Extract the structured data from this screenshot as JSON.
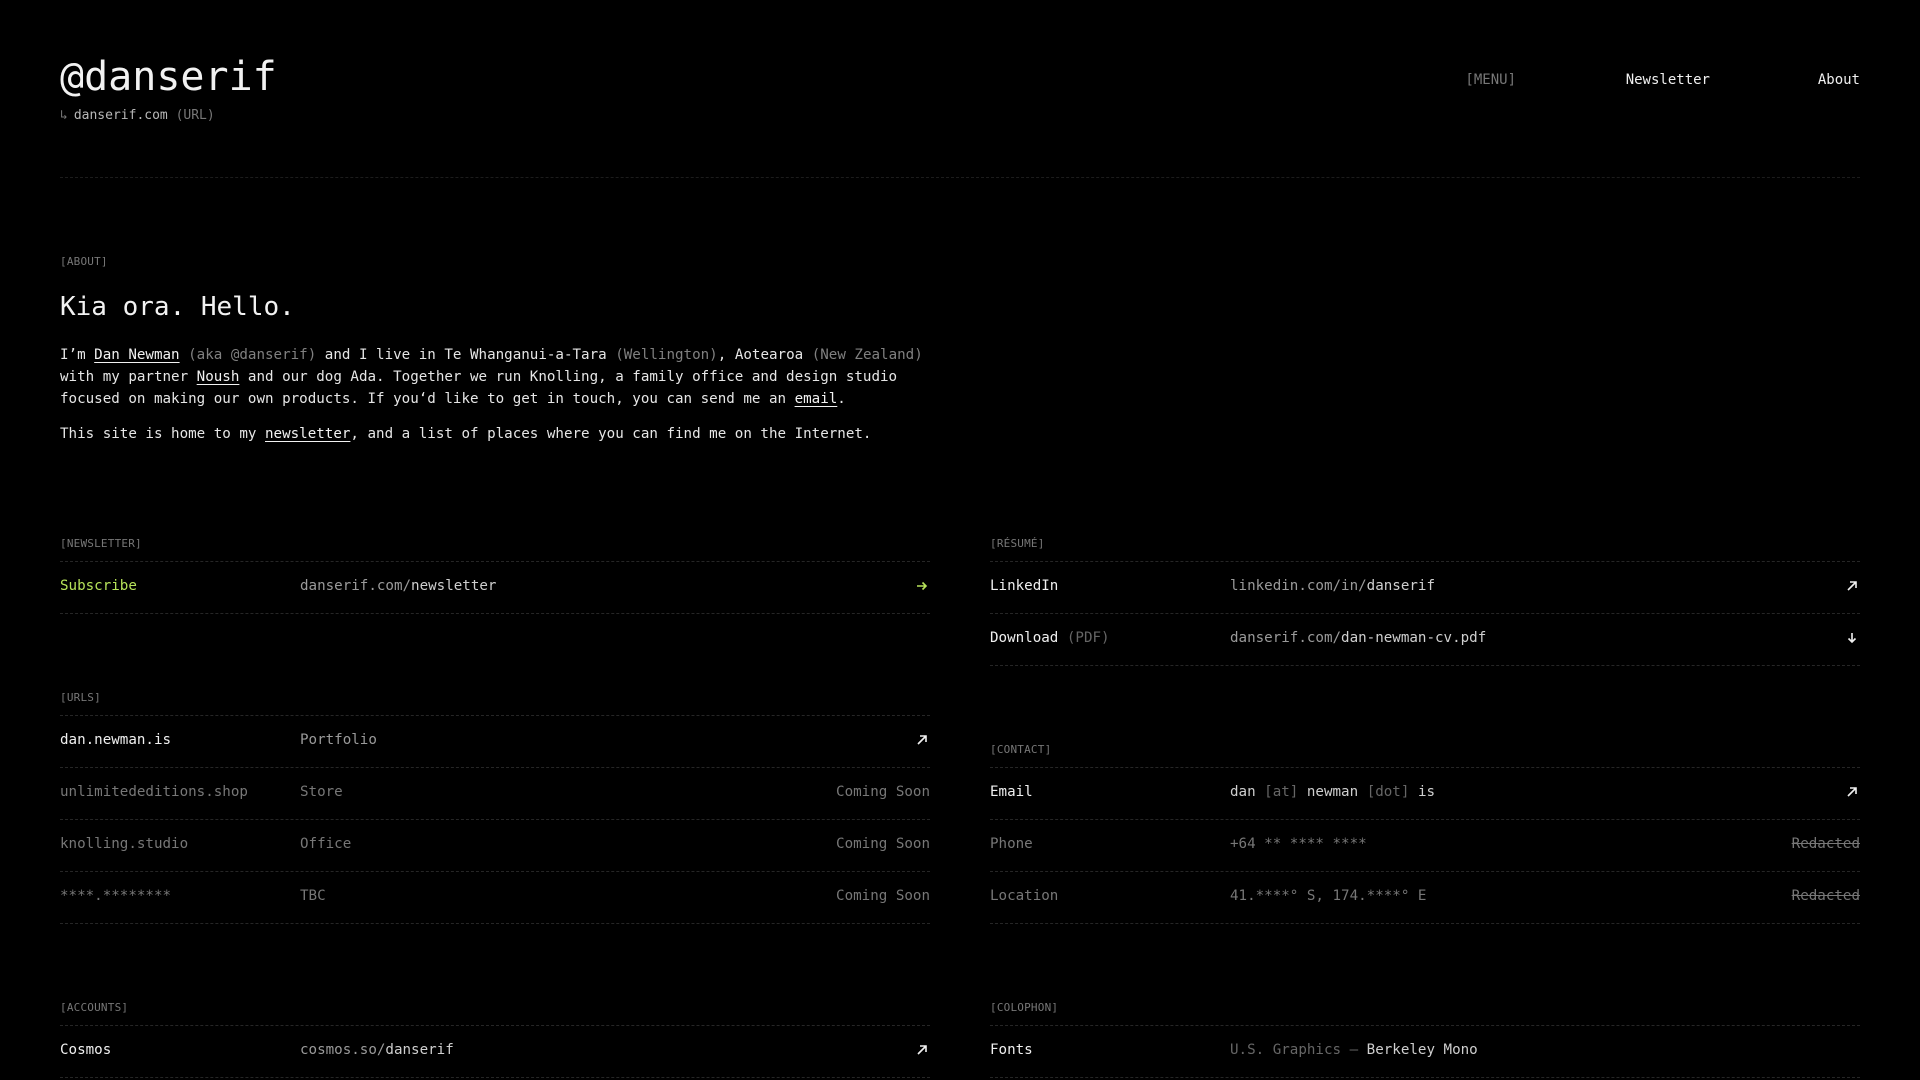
{
  "header": {
    "logo": "@danserif",
    "sub_arrow": "↳",
    "sub_domain": "danserif.com",
    "sub_tag": "(URL)",
    "nav": {
      "menu": "[MENU]",
      "newsletter": "Newsletter",
      "about": "About"
    }
  },
  "about": {
    "label": "[ABOUT]",
    "title": "Kia ora. Hello.",
    "p1": {
      "t1": "I’m ",
      "name": "Dan Newman",
      "aka": " (aka @danserif)",
      "t2": " and I live in Te Whanganui-a-Tara",
      "wellington": " (Wellington)",
      "t3": ", Aotearoa",
      "nz": " (New Zealand)",
      "t4": " with my partner ",
      "partner": "Noush",
      "t5": " and our dog Ada. Together we run Knolling, a family office and design studio focused on making our own products. If you‘d like to get in touch, you can send me an ",
      "email": "email",
      "t6": "."
    },
    "p2": {
      "t1": "This site is home to my ",
      "newsletter": "newsletter",
      "t2": ", and a list of places where you can find me on the Internet."
    }
  },
  "newsletter": {
    "label": "[NEWSLETTER]",
    "rows": [
      {
        "name": "Subscribe",
        "url_dim": "danserif.com/",
        "url_hi": "newsletter"
      }
    ]
  },
  "urls": {
    "label": "[URLS]",
    "rows": [
      {
        "name": "dan.newman.is",
        "desc": "Portfolio",
        "status": ""
      },
      {
        "name": "unlimitededitions.shop",
        "desc": "Store",
        "status": "Coming Soon"
      },
      {
        "name": "knolling.studio",
        "desc": "Office",
        "status": "Coming Soon"
      },
      {
        "name": "****.********",
        "desc": "TBC",
        "status": "Coming Soon"
      }
    ]
  },
  "accounts": {
    "label": "[ACCOUNTS]",
    "rows": [
      {
        "name": "Cosmos",
        "url_dim": "cosmos.so/",
        "url_hi": "danserif"
      }
    ]
  },
  "resume": {
    "label": "[RÉSUMÉ]",
    "rows": [
      {
        "name": "LinkedIn",
        "url_dim": "linkedin.com/in/",
        "url_hi": "danserif"
      },
      {
        "name": "Download",
        "name_tag": " (PDF)",
        "url_dim": "danserif.com/",
        "url_hi": "dan-newman-cv.pdf"
      }
    ]
  },
  "contact": {
    "label": "[CONTACT]",
    "rows": [
      {
        "name": "Email",
        "v1": "dan ",
        "v2": "[at]",
        "v3": " newman ",
        "v4": "[dot]",
        "v5": " is"
      },
      {
        "name": "Phone",
        "value": "+64 ** **** ****",
        "status": "Redacted"
      },
      {
        "name": "Location",
        "value": "41.****° S, 174.****° E",
        "status": "Redacted"
      }
    ]
  },
  "colophon": {
    "label": "[COLOPHON]",
    "rows": [
      {
        "name": "Fonts",
        "v_dim": "U.S. Graphics — ",
        "v_hi": "Berkeley Mono"
      }
    ]
  },
  "colors": {
    "background": "#000000",
    "accent_green": "#b7e35a",
    "text": "#e8e8e8",
    "muted": "#777777"
  },
  "icons": {
    "external": "arrow-up-right-icon",
    "subscribe": "arrow-right-icon",
    "download": "arrow-down-icon"
  }
}
